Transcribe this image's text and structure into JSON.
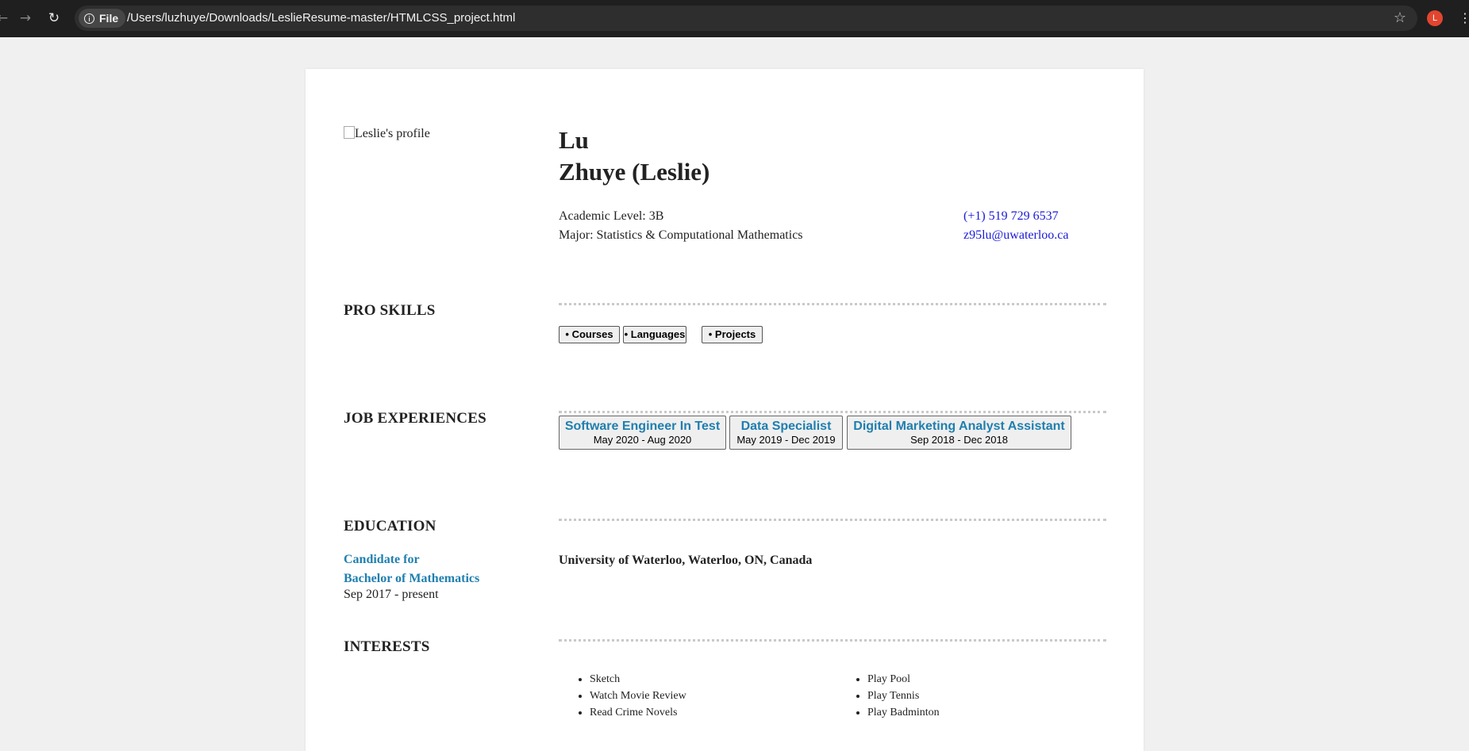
{
  "browser": {
    "back_icon": "arrow-left-icon",
    "forward_icon": "arrow-right-icon",
    "reload_icon": "reload-icon",
    "scheme_chip": "File",
    "url": "/Users/luzhuye/Downloads/LeslieResume-master/HTMLCSS_project.html",
    "bookmark_icon": "star-icon",
    "profile_initial": "L",
    "profile_color": "#e2452f"
  },
  "header": {
    "profile_image_alt": "Leslie's profile",
    "name_line1": "Lu",
    "name_line2": "Zhuye (Leslie)",
    "academic_level": "Academic Level: 3B",
    "major": "Major: Statistics & Computational Mathematics",
    "phone": "(+1) 519 729 6537",
    "email": "z95lu@uwaterloo.ca"
  },
  "skills": {
    "title": "PRO SKILLS",
    "buttons": [
      "• Courses",
      "• Languages",
      "• Projects"
    ]
  },
  "jobs": {
    "title": "JOB EXPERIENCES",
    "items": [
      {
        "title": "Software Engineer In Test",
        "dates": "May 2020 - Aug 2020"
      },
      {
        "title": "Data Specialist",
        "dates": "May 2019 - Dec 2019"
      },
      {
        "title": "Digital Marketing Analyst Assistant",
        "dates": "Sep 2018 - Dec 2018"
      }
    ]
  },
  "education": {
    "title": "EDUCATION",
    "degree_line1": "Candidate for",
    "degree_line2": "Bachelor of Mathematics",
    "dates": "Sep 2017 - present",
    "school": "University of Waterloo, Waterloo, ON, Canada"
  },
  "interests": {
    "title": "INTERESTS",
    "left": [
      "Sketch",
      "Watch Movie Review",
      "Read Crime Novels"
    ],
    "right": [
      "Play Pool",
      "Play Tennis",
      "Play Badminton"
    ]
  },
  "colors": {
    "accent": "#1f7faf",
    "link": "#1a1adb",
    "page_bg": "#f0f0f0",
    "chrome_bg": "#1f1f1f"
  }
}
